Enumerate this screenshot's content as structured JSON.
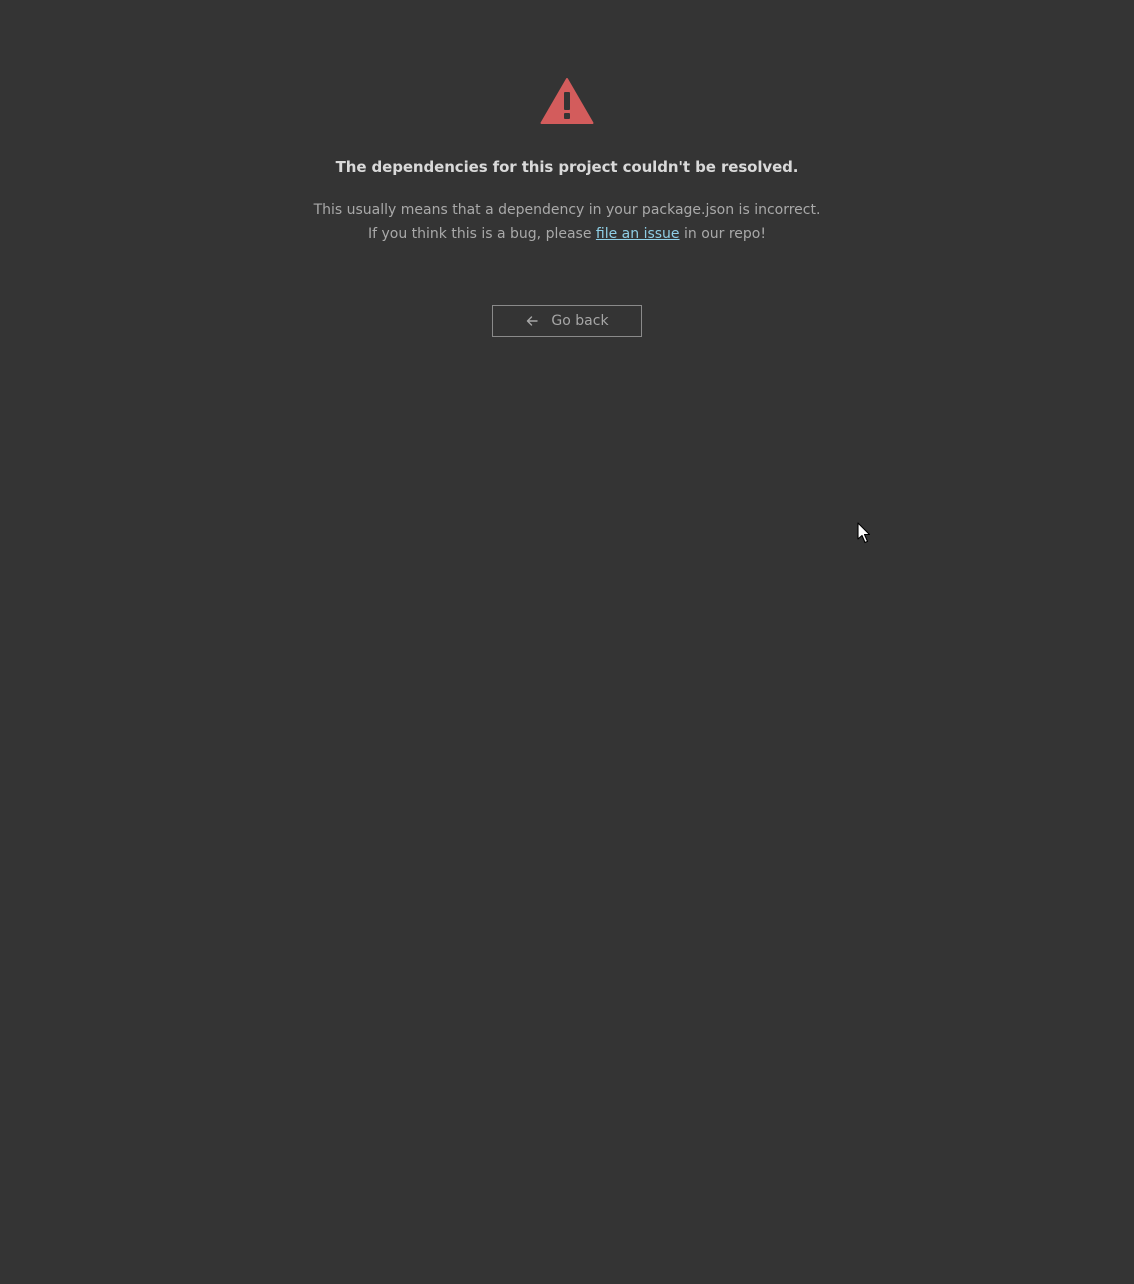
{
  "error": {
    "icon": "warning-triangle-icon",
    "icon_color": "#d35c5c",
    "title": "The dependencies for this project couldn't be resolved.",
    "message_line1": "This usually means that a dependency in your package.json is incorrect.",
    "message_line2_prefix": "If you think this is a bug, please ",
    "link_text": "file an issue",
    "message_line2_suffix": " in our repo!"
  },
  "actions": {
    "back_icon": "arrow-left-icon",
    "back_label": "Go back"
  },
  "colors": {
    "background": "#343434",
    "link": "#8fcfe6"
  }
}
